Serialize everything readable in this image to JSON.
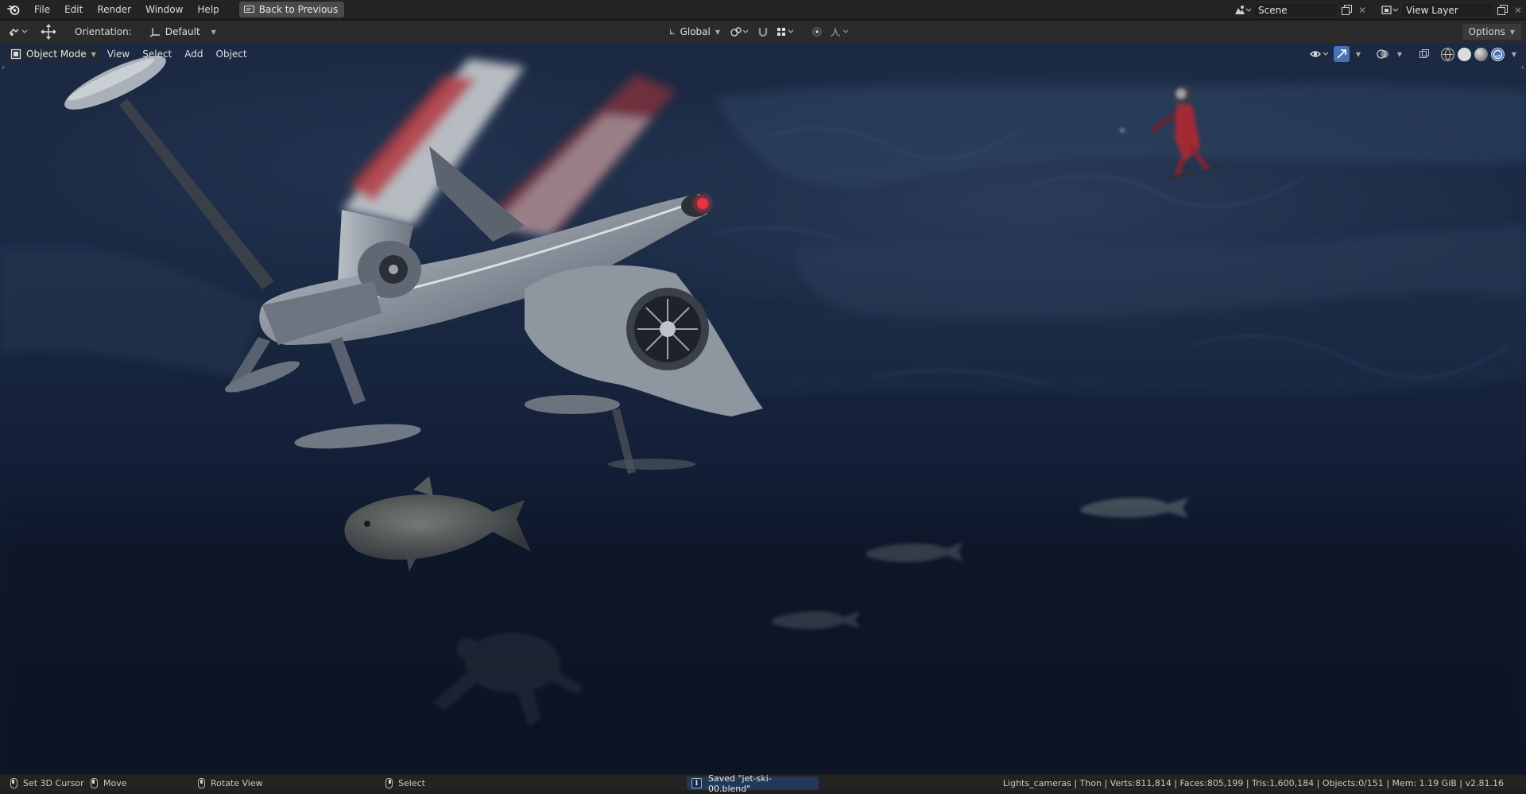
{
  "menubar": {
    "logo": "blender-logo-icon",
    "items": [
      "File",
      "Edit",
      "Render",
      "Window",
      "Help"
    ],
    "back_button": "Back to Previous",
    "scene": "Scene",
    "view_layer": "View Layer"
  },
  "toolheader": {
    "orientation_label": "Orientation:",
    "orientation_value": "Default",
    "transform_orientation": "Global",
    "options_label": "Options"
  },
  "viewport": {
    "mode": "Object Mode",
    "menus": [
      "View",
      "Select",
      "Add",
      "Object"
    ]
  },
  "statusbar": {
    "set_cursor": "Set 3D Cursor",
    "move": "Move",
    "rotate": "Rotate View",
    "select": "Select",
    "report": "Saved \"jet-ski-00.blend\"",
    "stats": "Lights_cameras | Thon | Verts:811,814 | Faces:805,199 | Tris:1,600,184 | Objects:0/151 | Mem: 1.19 GiB | v2.81.16"
  },
  "colors": {
    "accent": "#4772b3",
    "report_bg": "#233858",
    "underwater_top": "#1c2943",
    "underwater_bottom": "#0c1527"
  }
}
